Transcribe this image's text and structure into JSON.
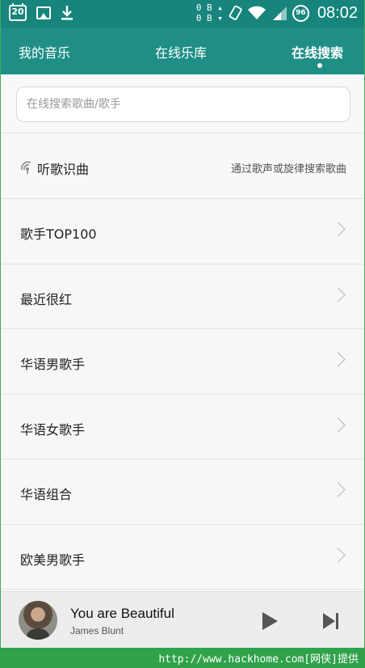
{
  "status_bar": {
    "calendar_day": "20",
    "net_up": "0 B",
    "net_down": "0 B",
    "battery": "96",
    "time": "08:02",
    "icons": [
      "calendar-icon",
      "image-icon",
      "download-icon",
      "rotate-icon",
      "wifi-icon",
      "signal-icon",
      "battery-icon"
    ]
  },
  "tabs": [
    {
      "label": "我的音乐"
    },
    {
      "label": "在线乐库"
    },
    {
      "label": "在线搜索",
      "active": true
    }
  ],
  "search": {
    "placeholder": "在线搜索歌曲/歌手",
    "value": ""
  },
  "recognize": {
    "title": "听歌识曲",
    "hint": "通过歌声或旋律搜索歌曲"
  },
  "categories": [
    {
      "label": "歌手TOP100"
    },
    {
      "label": "最近很红"
    },
    {
      "label": "华语男歌手"
    },
    {
      "label": "华语女歌手"
    },
    {
      "label": "华语组合"
    },
    {
      "label": "欧美男歌手"
    }
  ],
  "player": {
    "song": "You are Beautiful",
    "artist": "James Blunt"
  },
  "footer": {
    "watermark": "http://www.hackhome.com[网侠]提供"
  },
  "colors": {
    "status_bar": "#17857c",
    "header": "#1f8f86",
    "page_frame": "#2fa24a"
  }
}
